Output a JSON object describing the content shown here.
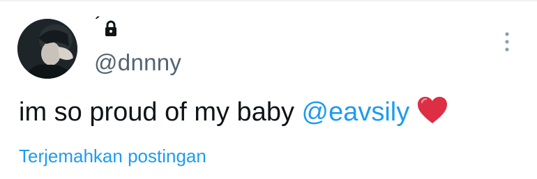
{
  "tweet": {
    "display_name": "´",
    "handle": "@dnnny",
    "text_prefix": "im so proud of my baby ",
    "mention": "@eavsily",
    "emoji": "red-heart-emoji",
    "translate_label": "Terjemahkan postingan"
  },
  "icons": {
    "lock": "lock-icon",
    "more": "more-vertical-icon",
    "heart": "red-heart-emoji"
  },
  "colors": {
    "text": "#0f1419",
    "secondary": "#536471",
    "link": "#1d9bf0",
    "heart": "#e0245e"
  }
}
